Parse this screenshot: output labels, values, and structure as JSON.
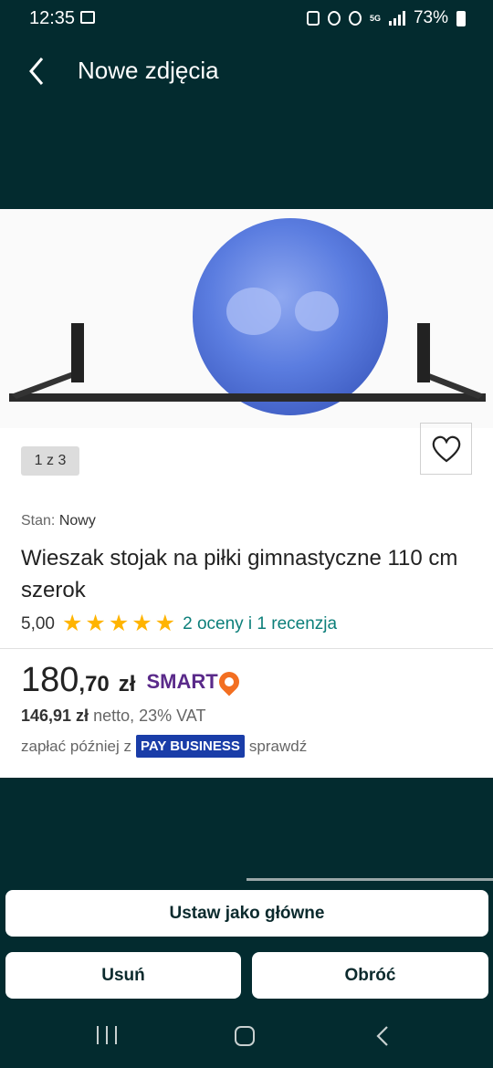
{
  "status": {
    "time": "12:35",
    "net_type": "5G",
    "battery": "73%"
  },
  "header": {
    "title": "Nowe zdjęcia",
    "back_icon": "chevron-left-icon"
  },
  "product": {
    "image_counter": "1 z 3",
    "condition_label": "Stan:",
    "condition_value": "Nowy",
    "title": "Wieszak stojak na piłki gimnastyczne 110 cm szerok",
    "rating_value": "5,00",
    "stars": 5,
    "reviews_link": "2 oceny i 1 recenzja",
    "price_main": "180",
    "price_fraction": ",70",
    "price_currency": "zł",
    "smart_logo": "SMART",
    "net_price": "146,91 zł",
    "net_label": "netto, 23% VAT",
    "pay_later_text": "zapłać później z",
    "pay_badge": "PAY BUSINESS",
    "check_link": "sprawdź",
    "favorite_icon": "heart-icon"
  },
  "actions": {
    "set_main": "Ustaw jako główne",
    "delete": "Usuń",
    "rotate": "Obróć"
  },
  "colors": {
    "background": "#032b2f",
    "star": "#ffb400",
    "link": "#0c7f7a",
    "smart": "#5a2a8a",
    "pay_badge": "#1a3da8"
  }
}
